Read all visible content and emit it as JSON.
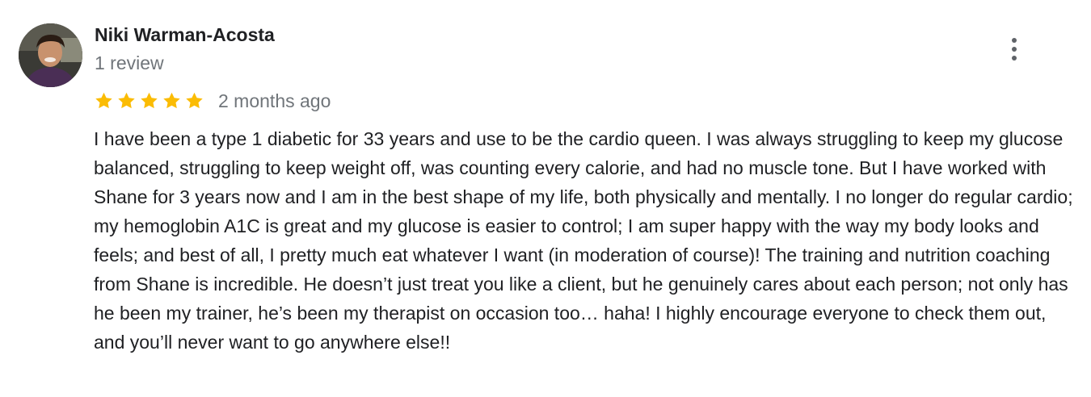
{
  "reviewer": {
    "name": "Niki Warman-Acosta",
    "review_count": "1 review"
  },
  "rating": {
    "stars": 5,
    "max_stars": 5,
    "star_color": "#fbbc04",
    "time_ago": "2 months ago"
  },
  "review_text": "I have been a type 1 diabetic for 33 years and use to be the cardio queen. I was always struggling to keep my glucose balanced, struggling to keep weight off, was counting every calorie, and had no muscle tone. But I have worked with Shane for 3 years now and I am in the best shape of my life, both physically and mentally. I no longer do regular cardio; my hemoglobin A1C is great and my glucose is easier to control; I am super happy with the way my body looks and feels; and best of all, I pretty much eat whatever I want (in moderation of course)! The training and nutrition coaching from Shane is incredible. He doesn’t just treat you like a client, but he genuinely cares about each person; not only has he been my trainer, he’s been my therapist on occasion too… haha! I highly encourage everyone to check them out, and you’ll never want to go anywhere else!!",
  "icons": {
    "more": "more-vert-icon",
    "star": "star-icon"
  }
}
